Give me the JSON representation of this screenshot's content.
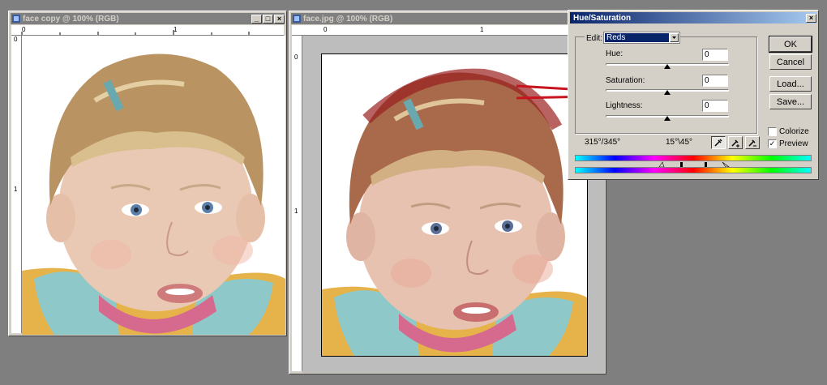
{
  "doc1": {
    "title": "face copy @ 100% (RGB)",
    "ruler_h": [
      "0",
      "1"
    ],
    "ruler_v": [
      "0",
      "1"
    ]
  },
  "doc2": {
    "title": "face.jpg @ 100% (RGB)",
    "ruler_h": [
      "0",
      "1"
    ],
    "ruler_v": [
      "0",
      "1"
    ]
  },
  "dialog": {
    "title": "Hue/Saturation",
    "close_glyph": "×",
    "edit_label": "Edit:",
    "edit_value": "Reds",
    "hue_label": "Hue:",
    "hue_value": "0",
    "saturation_label": "Saturation:",
    "saturation_value": "0",
    "lightness_label": "Lightness:",
    "lightness_value": "0",
    "range_left": "315°/345°",
    "range_right": "15°\\45°",
    "ok_label": "OK",
    "cancel_label": "Cancel",
    "load_label": "Load...",
    "save_label": "Save...",
    "colorize_label": "Colorize",
    "colorize_checked": false,
    "preview_label": "Preview",
    "preview_checked": true
  },
  "colors": {
    "titlebar_active": "#0a246a",
    "titlebar_inactive": "#808080",
    "face": "#e8c6b0",
    "hair": "#b99462",
    "jacket": "#e6b24a",
    "collar": "#8fc8c8"
  }
}
